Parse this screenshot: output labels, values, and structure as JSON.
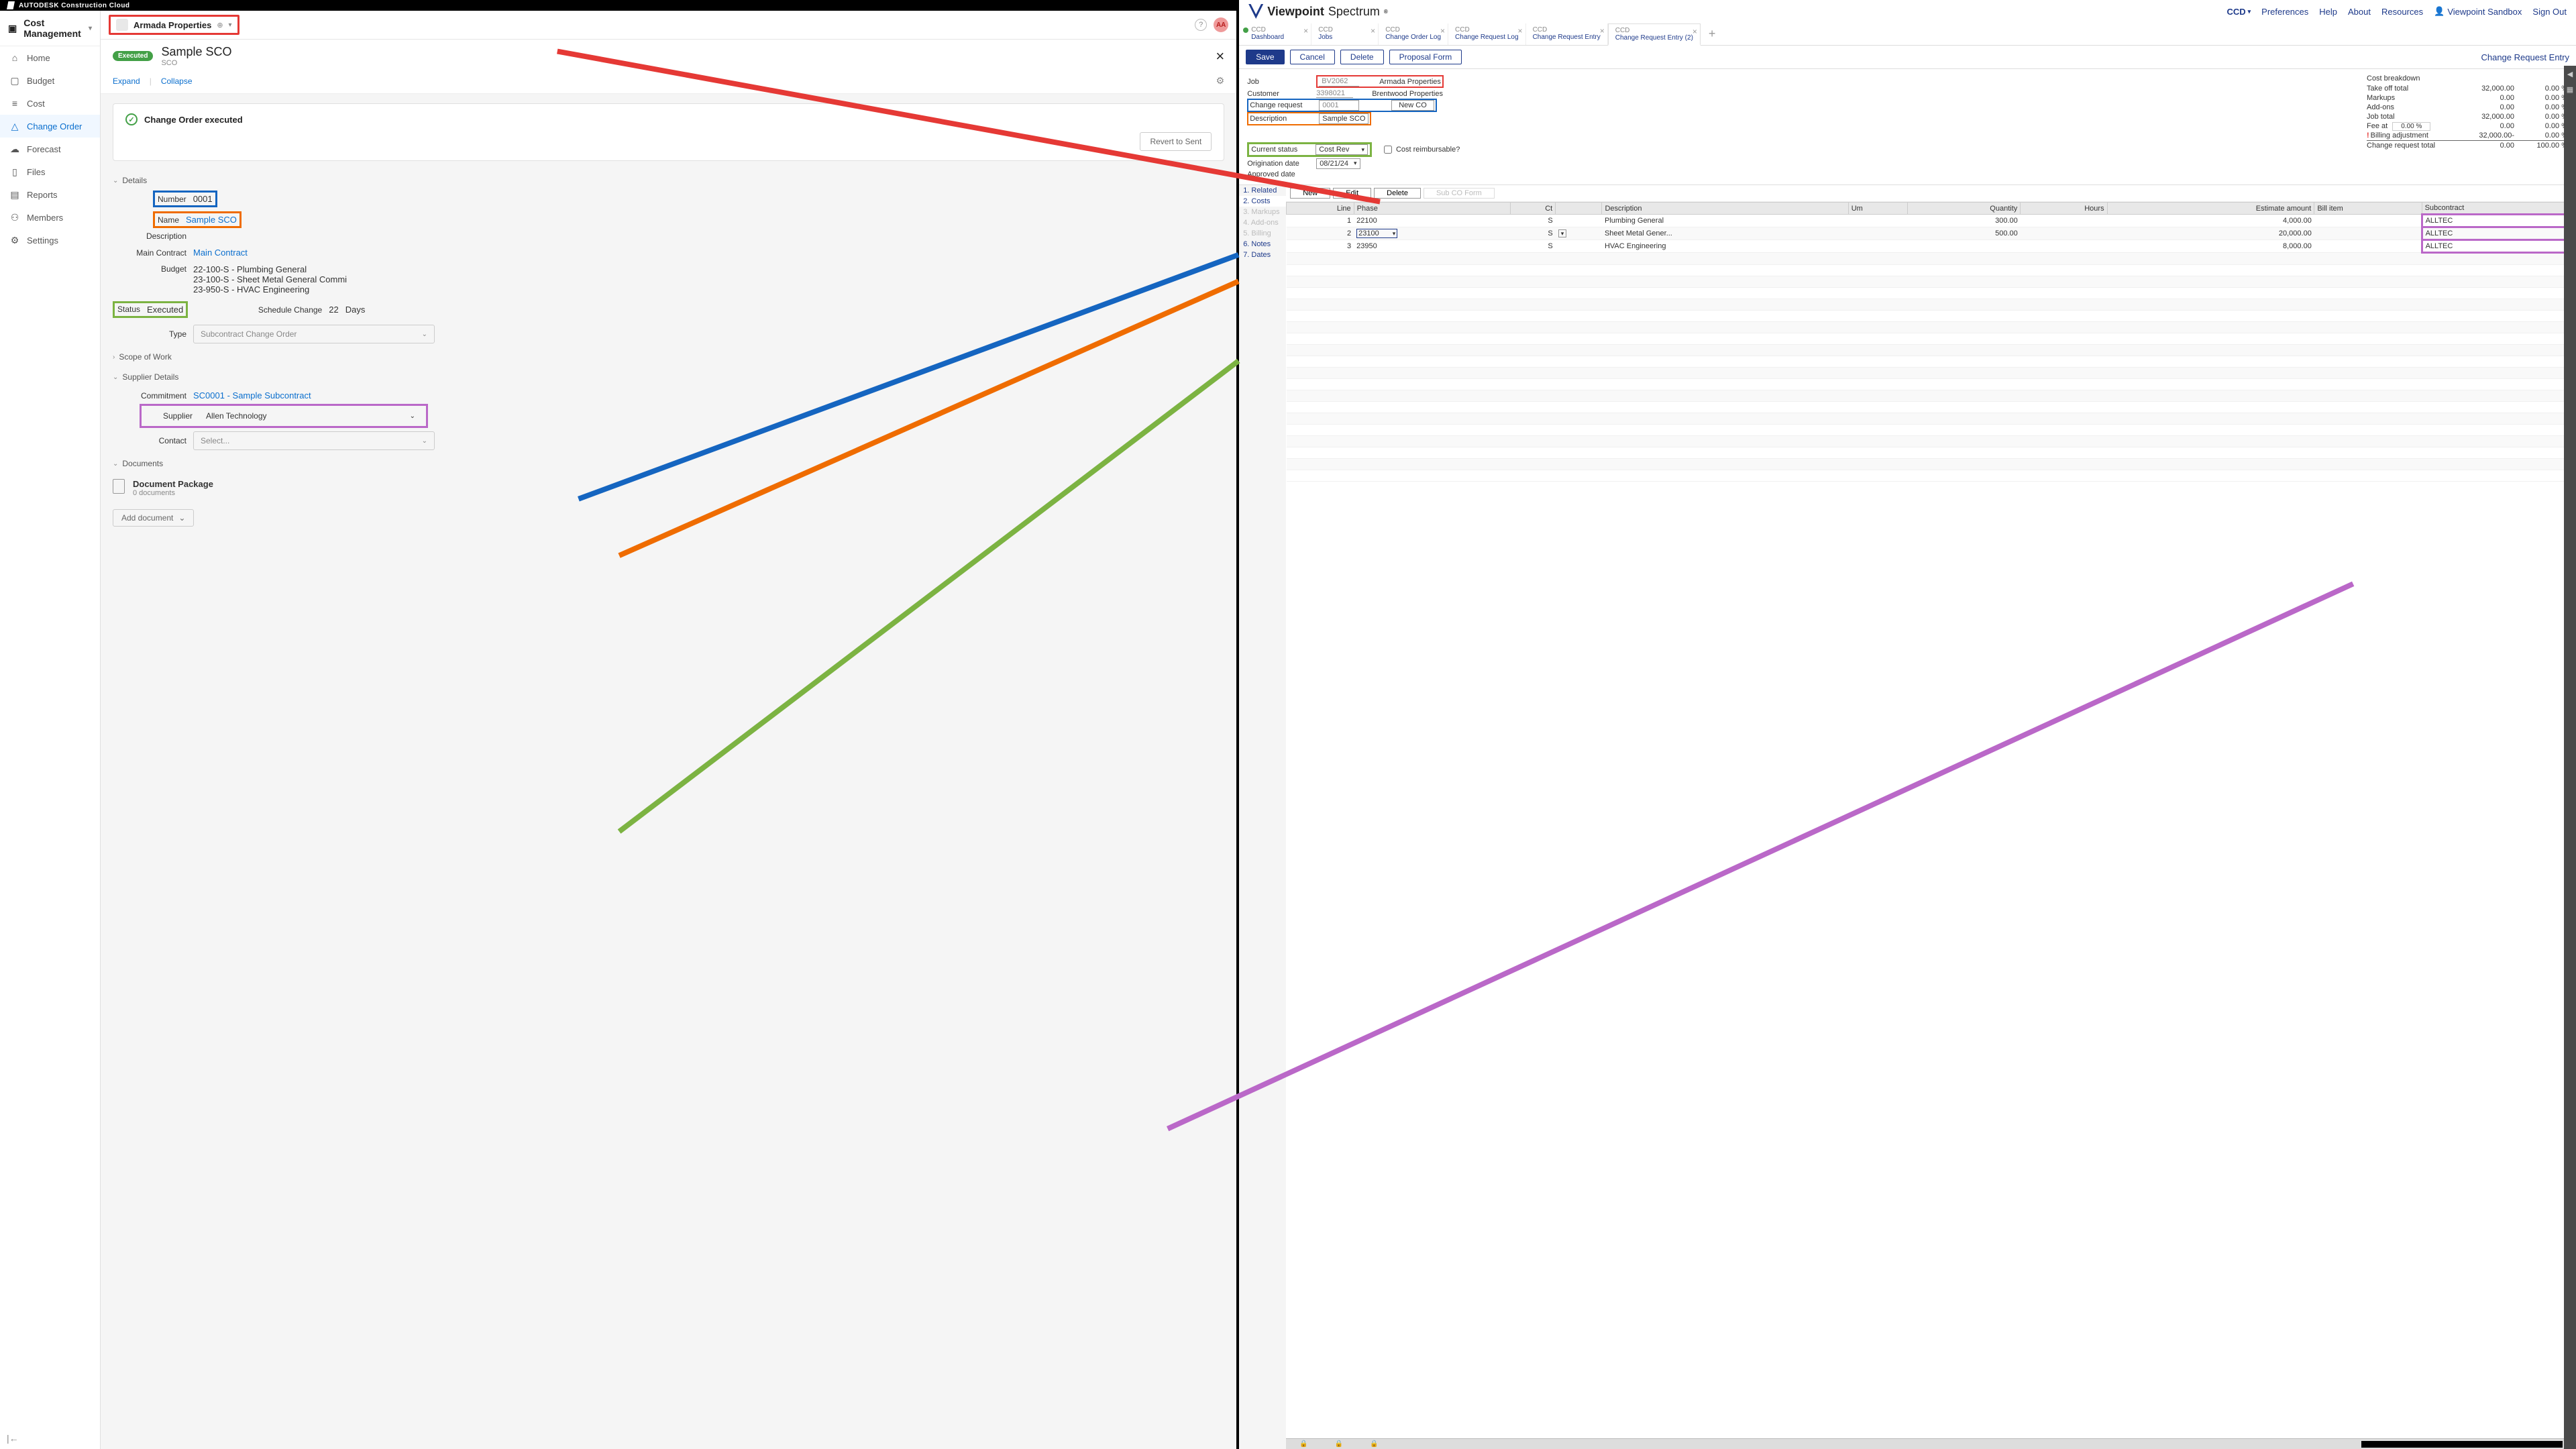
{
  "autodesk": {
    "brand": "AUTODESK Construction Cloud",
    "module": "Cost Management",
    "sidebar": [
      {
        "icon": "⌂",
        "label": "Home"
      },
      {
        "icon": "▢",
        "label": "Budget"
      },
      {
        "icon": "≡",
        "label": "Cost"
      },
      {
        "icon": "△",
        "label": "Change Order",
        "active": true
      },
      {
        "icon": "☁",
        "label": "Forecast"
      },
      {
        "icon": "▯",
        "label": "Files"
      },
      {
        "icon": "▤",
        "label": "Reports"
      },
      {
        "icon": "⚇",
        "label": "Members"
      },
      {
        "icon": "⚙",
        "label": "Settings"
      }
    ],
    "project": "Armada Properties",
    "avatar": "AA",
    "statusBadge": "Executed",
    "title": "Sample SCO",
    "subtitle": "SCO",
    "expand": "Expand",
    "collapse": "Collapse",
    "cardStatus": "Change Order executed",
    "revert": "Revert to Sent",
    "sections": {
      "details": "Details",
      "scope": "Scope of Work",
      "supplier": "Supplier Details",
      "docs": "Documents"
    },
    "fields": {
      "numberLabel": "Number",
      "number": "0001",
      "nameLabel": "Name",
      "name": "Sample SCO",
      "descLabel": "Description",
      "mainContractLabel": "Main Contract",
      "mainContract": "Main Contract",
      "budgetLabel": "Budget",
      "budgets": [
        "22-100-S - Plumbing General",
        "23-100-S - Sheet Metal General Commi",
        "23-950-S - HVAC Engineering"
      ],
      "statusLabel": "Status",
      "status": "Executed",
      "scheduleLabel": "Schedule Change",
      "schedule": "22",
      "scheduleUnit": "Days",
      "typeLabel": "Type",
      "type": "Subcontract Change Order",
      "commitmentLabel": "Commitment",
      "commitment": "SC0001 - Sample Subcontract",
      "supplierLabel": "Supplier",
      "supplier": "Allen Technology",
      "contactLabel": "Contact",
      "contact": "Select...",
      "docPkg": "Document Package",
      "docCount": "0 documents",
      "addDoc": "Add document"
    }
  },
  "viewpoint": {
    "brand1": "Viewpoint",
    "brand2": "Spectrum",
    "nav": [
      "Preferences",
      "Help",
      "About",
      "Resources"
    ],
    "ccd": "CCD",
    "user": "Viewpoint Sandbox",
    "signout": "Sign Out",
    "tabs": [
      {
        "l1": "CCD",
        "l2": "Dashboard",
        "dot": true
      },
      {
        "l1": "CCD",
        "l2": "Jobs"
      },
      {
        "l1": "CCD",
        "l2": "Change Order Log"
      },
      {
        "l1": "CCD",
        "l2": "Change Request Log"
      },
      {
        "l1": "CCD",
        "l2": "Change Request Entry"
      },
      {
        "l1": "CCD",
        "l2": "Change Request Entry (2)",
        "active": true
      }
    ],
    "buttons": {
      "save": "Save",
      "cancel": "Cancel",
      "delete": "Delete",
      "proposal": "Proposal Form"
    },
    "pageTitle": "Change Request Entry",
    "form": {
      "jobLabel": "Job",
      "job": "BV2062",
      "jobName": "Armada Properties",
      "customerLabel": "Customer",
      "customer": "3398021",
      "customerName": "Brentwood Properties",
      "crLabel": "Change request",
      "cr": "0001",
      "newCO": "New CO",
      "descLabel": "Description",
      "desc": "Sample SCO",
      "statusLabel": "Current status",
      "status": "Cost Rev",
      "reimbLabel": "Cost reimbursable?",
      "origLabel": "Origination date",
      "orig": "08/21/24",
      "apprLabel": "Approved date"
    },
    "cb": {
      "title": "Cost breakdown",
      "rows": [
        {
          "n": "Take off total",
          "v": "32,000.00",
          "p": "0.00 %"
        },
        {
          "n": "Markups",
          "v": "0.00",
          "p": "0.00 %"
        },
        {
          "n": "Add-ons",
          "v": "0.00",
          "p": "0.00 %"
        },
        {
          "n": "Job total",
          "v": "32,000.00",
          "p": "0.00 %"
        },
        {
          "n": "Fee at",
          "v": "0.00",
          "p": "0.00 %",
          "fee": "0.00 %"
        },
        {
          "n": "Billing adjustment",
          "v": "32,000.00-",
          "p": "0.00 %",
          "warn": true
        },
        {
          "n": "Change request total",
          "v": "0.00",
          "p": "100.00 %"
        }
      ]
    },
    "subnav": [
      "1. Related",
      "2. Costs",
      "3. Markups",
      "4. Add-ons",
      "5. Billing",
      "6. Notes",
      "7. Dates"
    ],
    "subnavDisabled": [
      2,
      3,
      4
    ],
    "subButtons": {
      "new": "New",
      "edit": "Edit",
      "delete": "Delete",
      "subco": "Sub CO Form"
    },
    "gridCols": [
      "Line",
      "Phase",
      "Ct",
      "",
      "Description",
      "Um",
      "Quantity",
      "Hours",
      "Estimate amount",
      "Bill item",
      "Subcontract"
    ],
    "gridRows": [
      {
        "line": "1",
        "phase": "22100",
        "ct": "S",
        "desc": "Plumbing General",
        "qty": "300.00",
        "est": "4,000.00",
        "sub": "ALLTEC"
      },
      {
        "line": "2",
        "phase": "23100",
        "ct": "S",
        "desc": "Sheet Metal Gener...",
        "qty": "500.00",
        "est": "20,000.00",
        "sub": "ALLTEC",
        "sel": true
      },
      {
        "line": "3",
        "phase": "23950",
        "ct": "S",
        "desc": "HVAC Engineering",
        "qty": "",
        "est": "8,000.00",
        "sub": "ALLTEC"
      }
    ]
  }
}
